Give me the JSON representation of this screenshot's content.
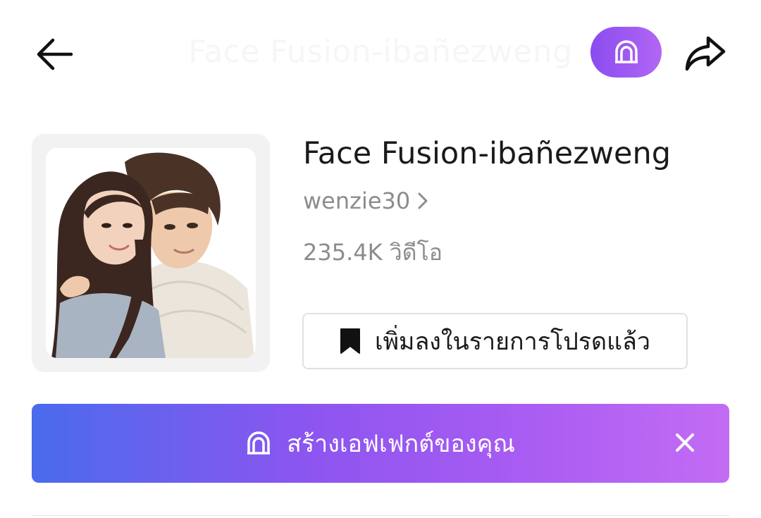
{
  "header": {
    "faded_title": "Face Fusion-ibañezweng",
    "back_icon": "arrow-left-icon",
    "effect_icon": "arch-effect-icon",
    "share_icon": "share-arrow-icon",
    "accent_color": "#9b59f2"
  },
  "effect": {
    "title": "Face Fusion-ibañezweng",
    "author": "wenzie30",
    "author_chevron": "›",
    "video_count": "235.4K วิดีโอ",
    "favorite_label": "เพิ่มลงในรายการโปรดแล้ว",
    "favorite_icon": "bookmark-icon"
  },
  "banner": {
    "label": "สร้างเอฟเฟกต์ของคุณ",
    "icon": "arch-effect-icon",
    "close_icon": "close-icon",
    "gradient_start": "#4a6bec",
    "gradient_end": "#c36cf4"
  }
}
